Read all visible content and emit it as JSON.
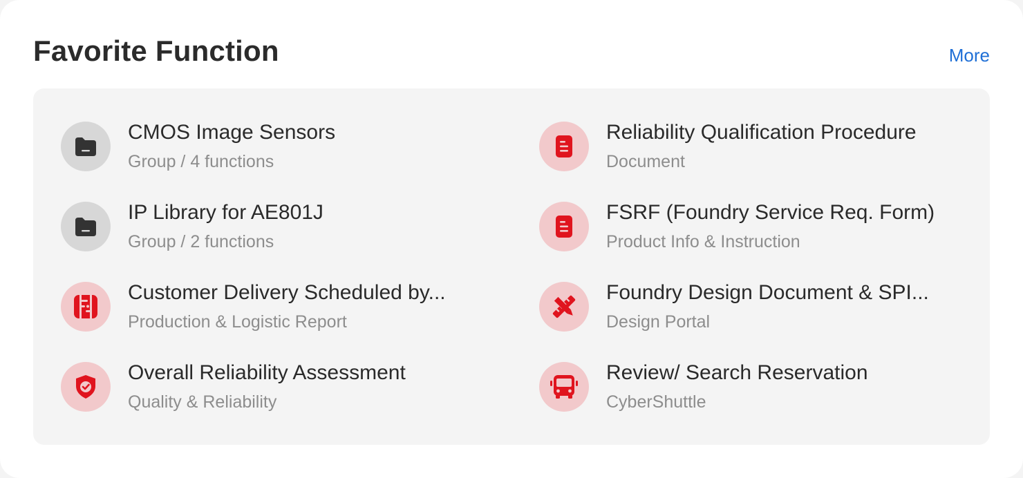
{
  "header": {
    "title": "Favorite Function",
    "more_label": "More"
  },
  "colors": {
    "accent_link": "#1f6fd6",
    "icon_red": "#e0141e",
    "icon_red_bg": "#f2c9cb",
    "icon_gray_bg": "#d7d7d7",
    "icon_dark": "#333333"
  },
  "items": [
    {
      "title": "CMOS Image Sensors",
      "subtitle": "Group / 4 functions",
      "icon": "folder-icon"
    },
    {
      "title": "Reliability Qualification Procedure",
      "subtitle": "Document",
      "icon": "document-icon"
    },
    {
      "title": "IP Library for AE801J",
      "subtitle": "Group / 2 functions",
      "icon": "folder-icon"
    },
    {
      "title": "FSRF (Foundry Service Req. Form)",
      "subtitle": "Product Info & Instruction",
      "icon": "document-icon"
    },
    {
      "title": "Customer Delivery Scheduled by...",
      "subtitle": "Production & Logistic Report",
      "icon": "logistics-icon"
    },
    {
      "title": "Foundry Design Document & SPI...",
      "subtitle": "Design Portal",
      "icon": "design-tools-icon"
    },
    {
      "title": "Overall Reliability Assessment",
      "subtitle": "Quality & Reliability",
      "icon": "shield-check-icon"
    },
    {
      "title": "Review/ Search Reservation",
      "subtitle": "CyberShuttle",
      "icon": "bus-icon"
    }
  ]
}
